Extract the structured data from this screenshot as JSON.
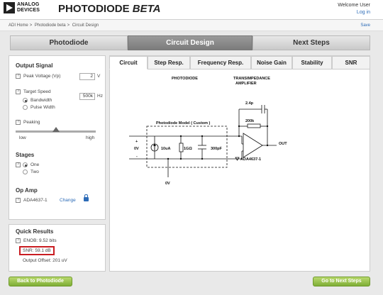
{
  "header": {
    "brand_line1": "ANALOG",
    "brand_line2": "DEVICES",
    "title": "PHOTODIODE",
    "title_suffix": "BETA",
    "welcome": "Welcome User",
    "login": "Log in"
  },
  "breadcrumb": {
    "items": [
      "ADI Home",
      "Photodiode beta",
      "Circuit Design"
    ],
    "separator": ">",
    "save": "Save"
  },
  "navtabs": [
    "Photodiode",
    "Circuit Design",
    "Next Steps"
  ],
  "left": {
    "output_signal": "Output Signal",
    "peak_voltage_label": "Peak Voltage (Vp)",
    "peak_voltage_value": "2",
    "peak_voltage_unit": "V",
    "target_speed_label": "Target Speed",
    "bandwidth": "Bandwidth",
    "pulse_width": "Pulse Width",
    "speed_value": "500k",
    "speed_unit": "Hz",
    "peaking": "Peaking",
    "slider_low": "low",
    "slider_high": "high",
    "peaking_level": 0.55,
    "stages": "Stages",
    "one": "One",
    "two": "Two",
    "opamp": "Op Amp",
    "opamp_value": "ADA4637-1",
    "change": "Change"
  },
  "quick": {
    "title": "Quick Results",
    "enob": "ENOB: 9.52 bits",
    "snr": "SNR: 59.1 dB",
    "offset": "Output Offset: 201 uV"
  },
  "circuit_tabs": [
    "Circuit",
    "Step Resp.",
    "Frequency Resp.",
    "Noise Gain",
    "Stability",
    "SNR"
  ],
  "schematic": {
    "photodiode": "PHOTODIODE",
    "transimpedance": "TRANSIMPEDANCE",
    "amplifier": "AMPLIFIER",
    "model": "Photodiode Model ( Custom )",
    "cap_feedback": "2.4p",
    "res_feedback": "200k",
    "current": "10uA",
    "shunt_r": "1GΩ",
    "junction_c": "300pF",
    "zero_v": "0V",
    "zero_v_bottom": "0V",
    "plus": "+",
    "minus": "-",
    "out": "OUT",
    "opamp": "ADA4637-1"
  },
  "buttons": {
    "back": "Back to Photodiode",
    "next": "Go to Next Steps"
  }
}
